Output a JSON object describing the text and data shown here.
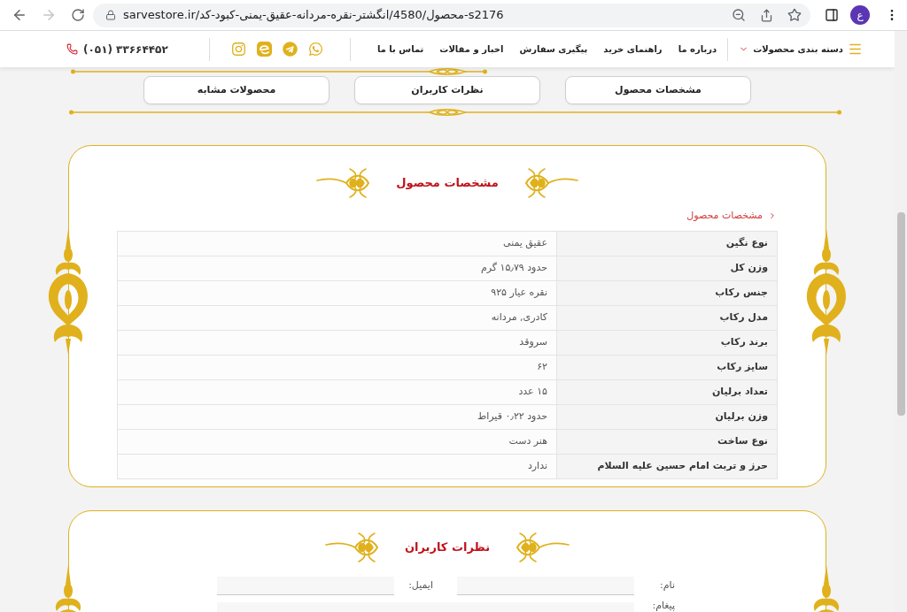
{
  "browser": {
    "back": {
      "disabled": false
    },
    "forward": {
      "disabled": true
    },
    "url": "sarvestore.ir/محصول/4580/انگشتر-نقره-مردانه-عقیق-یمنی-کبود-کد-s2176",
    "profile_initial": "ع"
  },
  "nav": {
    "categories": "دسته بندی محصولات",
    "links": [
      "درباره ما",
      "راهنمای خرید",
      "پیگیری سفارش",
      "اخبار و مقالات",
      "تماس با ما"
    ],
    "phone": "(۰۵۱) ۳۳۶۶۴۴۵۲"
  },
  "tabs": [
    {
      "label": "مشخصات محصول"
    },
    {
      "label": "نظرات کاربران"
    },
    {
      "label": "محصولات مشابه"
    }
  ],
  "specs": {
    "title": "مشخصات محصول",
    "breadcrumb": "مشخصات محصول",
    "rows": [
      {
        "label": "نوع نگین",
        "value": "عقیق یمنی"
      },
      {
        "label": "وزن کل",
        "value": "حدود ۱۵٫۷۹ گرم"
      },
      {
        "label": "جنس رکاب",
        "value": "نقره عیار ۹۲۵"
      },
      {
        "label": "مدل رکاب",
        "value": "کادری, مردانه"
      },
      {
        "label": "برند رکاب",
        "value": "سروقد"
      },
      {
        "label": "سایز رکاب",
        "value": "۶۲"
      },
      {
        "label": "تعداد برلیان",
        "value": "۱۵ عدد"
      },
      {
        "label": "وزن برلیان",
        "value": "حدود ۰٫۲۲ قیراط"
      },
      {
        "label": "نوع ساخت",
        "value": "هنر دست"
      },
      {
        "label": "حرز و تربت امام حسین علیه السلام",
        "value": "ندارد"
      }
    ]
  },
  "reviews": {
    "title": "نظرات کاربران",
    "fields": [
      {
        "label": "نام:"
      },
      {
        "label": "ایمیل:"
      }
    ],
    "message": {
      "label": "پیغام:"
    }
  }
}
